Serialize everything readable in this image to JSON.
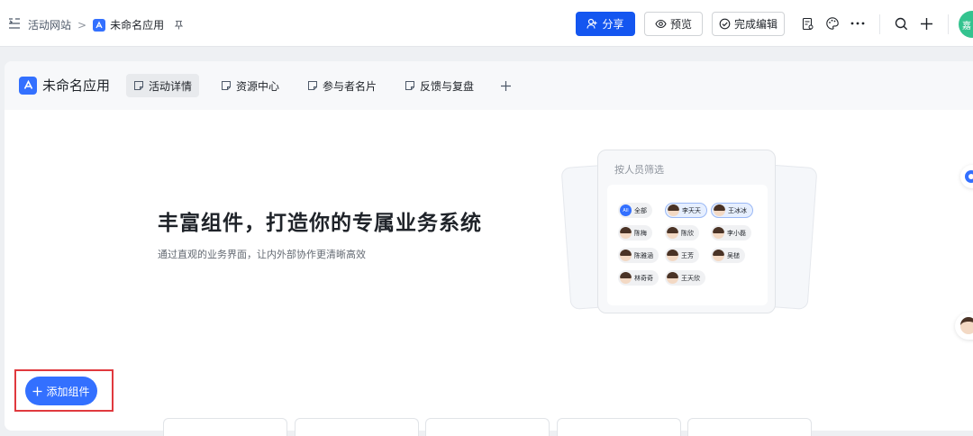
{
  "breadcrumb": {
    "parent": "活动网站",
    "separator": ">",
    "title": "未命名应用"
  },
  "toolbar": {
    "share_label": "分享",
    "preview_label": "预览",
    "finish_label": "完成编辑",
    "user_avatar_text": "嘉"
  },
  "app": {
    "name": "未命名应用",
    "tabs": [
      {
        "label": "活动详情",
        "active": true
      },
      {
        "label": "资源中心",
        "active": false
      },
      {
        "label": "参与者名片",
        "active": false
      },
      {
        "label": "反馈与复盘",
        "active": false
      }
    ]
  },
  "hero": {
    "headline": "丰富组件，打造你的专属业务系统",
    "subline": "通过直观的业务界面，让内外部协作更清晰高效"
  },
  "illustration": {
    "panel_title": "按人员筛选",
    "chips": [
      {
        "label": "全部",
        "avatar": "All",
        "selected": false
      },
      {
        "label": "李天天",
        "selected": true
      },
      {
        "label": "王冰冰",
        "selected": true
      },
      {
        "label": "陈梅",
        "selected": false
      },
      {
        "label": "陈欣",
        "selected": false
      },
      {
        "label": "李小磊",
        "selected": false
      },
      {
        "label": "陈雅涵",
        "selected": false
      },
      {
        "label": "王芳",
        "selected": false
      },
      {
        "label": "吴槌",
        "selected": false
      },
      {
        "label": "林奇奇",
        "selected": false
      },
      {
        "label": "王天欣",
        "selected": false
      }
    ]
  },
  "actions": {
    "add_component_label": "添加组件"
  },
  "colors": {
    "primary": "#3370ff",
    "share_button": "#1456f0",
    "highlight_box": "#e0393e",
    "avatar_green": "#34c38f"
  }
}
